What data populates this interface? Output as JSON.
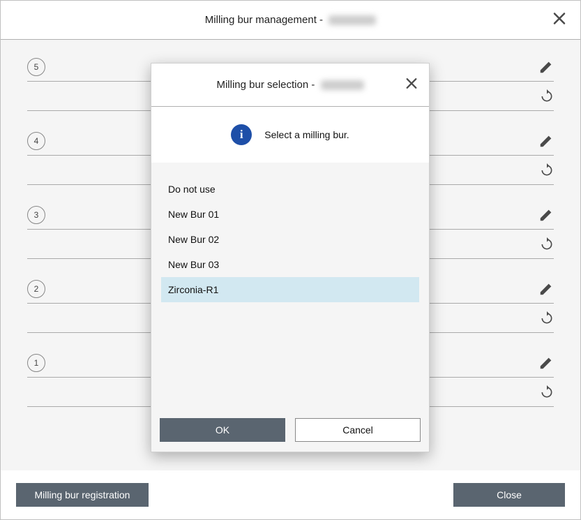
{
  "main": {
    "title": "Milling bur management - ",
    "slots": [
      {
        "num": "5"
      },
      {
        "num": "4"
      },
      {
        "num": "3"
      },
      {
        "num": "2"
      },
      {
        "num": "1"
      }
    ],
    "footer": {
      "registration_label": "Milling bur registration",
      "close_label": "Close"
    }
  },
  "modal": {
    "title": "Milling bur selection - ",
    "info_text": "Select a milling bur.",
    "items": [
      {
        "label": "Do not use",
        "selected": false
      },
      {
        "label": "New Bur 01",
        "selected": false
      },
      {
        "label": "New Bur 02",
        "selected": false
      },
      {
        "label": "New Bur 03",
        "selected": false
      },
      {
        "label": "Zirconia-R1",
        "selected": true
      }
    ],
    "ok_label": "OK",
    "cancel_label": "Cancel"
  },
  "icons": {
    "close_main": "close",
    "close_modal": "close",
    "pencil": "pencil",
    "refresh": "refresh",
    "info": "i"
  }
}
